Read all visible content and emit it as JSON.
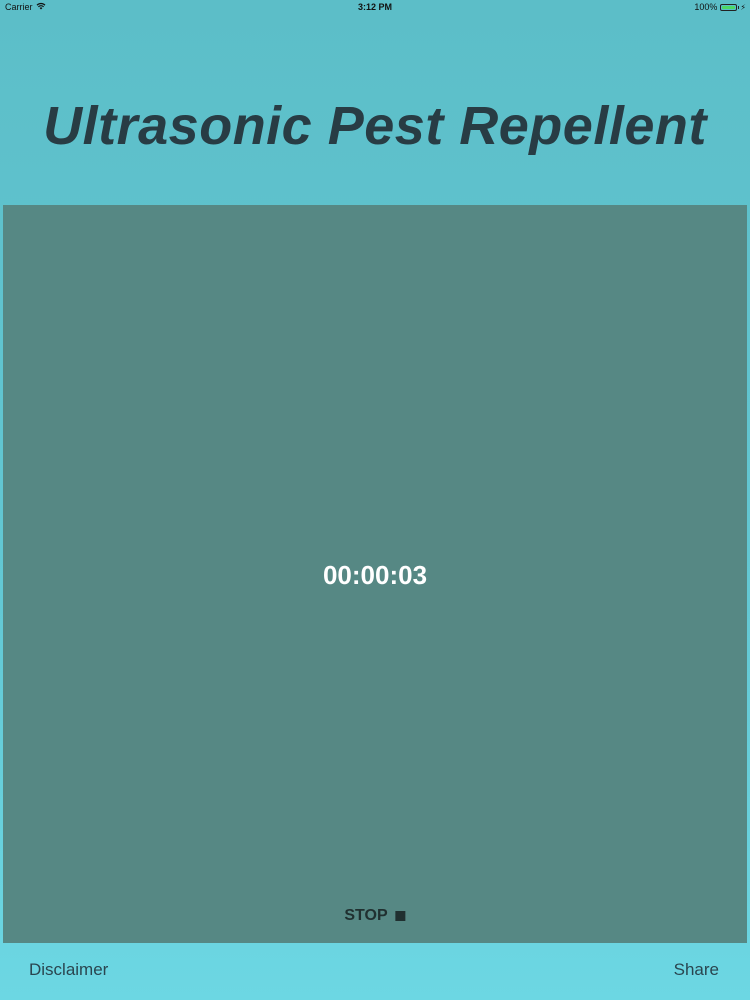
{
  "status_bar": {
    "carrier": "Carrier",
    "wifi_icon": "wifi-icon",
    "time": "3:12 PM",
    "battery_percent": "100%",
    "battery_level": 1.0,
    "battery_color": "#4cd964",
    "charging_icon": "bolt-icon"
  },
  "header": {
    "title": "Ultrasonic Pest Repellent"
  },
  "timer": {
    "elapsed": "00:00:03",
    "stop_label": "STOP",
    "stop_icon": "stop-square-icon"
  },
  "footer": {
    "disclaimer_label": "Disclaimer",
    "share_label": "Share"
  },
  "colors": {
    "background": "#63c8d4",
    "panel": "#568884",
    "title": "#283c44"
  }
}
